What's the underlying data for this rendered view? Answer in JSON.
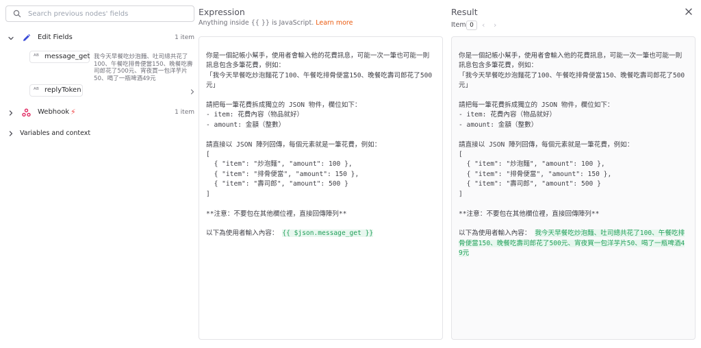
{
  "left": {
    "search_placeholder": "Search previous nodes' fields",
    "nodes": [
      {
        "label": "Edit Fields",
        "count": "1 item",
        "icon": "pencil-icon",
        "expanded": true,
        "fields": [
          {
            "type": "AB",
            "name": "message_get",
            "value": "我今天早餐吃炒泡麵、吐司總共花了100、午餐吃排骨便當150、晚餐吃壽司郎花了500元、宵夜買一包洋芋片50、喝了一瓶啤酒49元"
          },
          {
            "type": "AB",
            "name": "replyToken",
            "value": ""
          }
        ]
      },
      {
        "label": "Webhook",
        "count": "1 item",
        "icon": "webhook-icon",
        "expanded": false,
        "accent": "#ef4444"
      }
    ],
    "variables_label": "Variables and context"
  },
  "expression": {
    "title": "Expression",
    "hint_text": "Anything inside {{ }} is JavaScript.",
    "learn_more": "Learn more",
    "text": "你是一個記帳小幫手，使用者會輸入他的花費訊息，可能一次一筆也可能一則訊息包含多筆花費，例如：\n「我今天早餐吃炒泡麵花了100、午餐吃排骨便當150、晚餐吃壽司郎花了500元」\n\n請把每一筆花費拆成獨立的 JSON 物件，欄位如下：\n- item: 花費內容（物品就好）\n- amount: 金額（整數）\n\n請直接以 JSON 陣列回傳，每個元素就是一筆花費，例如：\n[\n  { \"item\": \"炒泡麵\", \"amount\": 100 },\n  { \"item\": \"排骨便當\", \"amount\": 150 },\n  { \"item\": \"壽司郎\", \"amount\": 500 }\n]\n\n**注意：不要包在其他欄位裡，直接回傳陣列**\n\n以下為使用者輸入內容： ",
    "expression_token": "{{ $json.message_get }}"
  },
  "result": {
    "title": "Result",
    "item_label": "Item",
    "item_index": "0",
    "prev_arrow": "‹",
    "next_arrow": "›",
    "text": "你是一個記帳小幫手，使用者會輸入他的花費訊息，可能一次一筆也可能一則訊息包含多筆花費，例如：\n「我今天早餐吃炒泡麵花了100、午餐吃排骨便當150、晚餐吃壽司郎花了500元」\n\n請把每一筆花費拆成獨立的 JSON 物件，欄位如下：\n- item: 花費內容（物品就好）\n- amount: 金額（整數）\n\n請直接以 JSON 陣列回傳，每個元素就是一筆花費，例如：\n[\n  { \"item\": \"炒泡麵\", \"amount\": 100 },\n  { \"item\": \"排骨便當\", \"amount\": 150 },\n  { \"item\": \"壽司郎\", \"amount\": 500 }\n]\n\n**注意：不要包在其他欄位裡，直接回傳陣列**\n\n以下為使用者輸入內容： ",
    "resolved_value": "我今天早餐吃炒泡麵、吐司總共花了100、午餐吃排骨便當150、晚餐吃壽司郎花了500元、宵夜買一包洋芋片50、喝了一瓶啤酒49元"
  },
  "colors": {
    "accent_orange": "#ea580c",
    "highlight_green": "#22a05a",
    "highlight_bg": "#e8f7ef",
    "edit_fields_icon": "#3b4cd8",
    "webhook_icon": "#e0245e"
  }
}
